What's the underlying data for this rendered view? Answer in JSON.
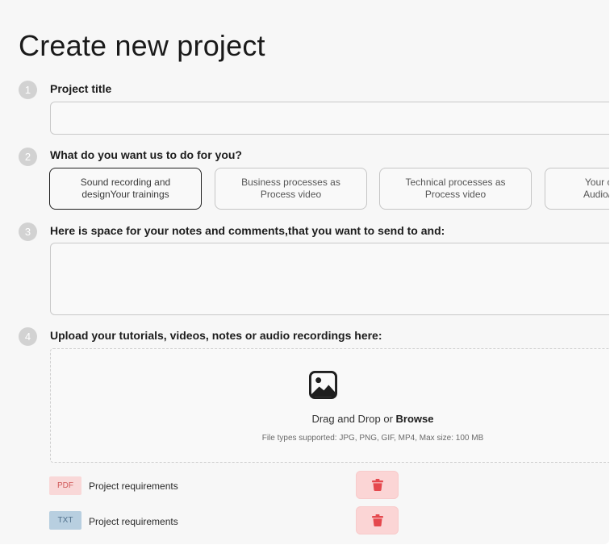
{
  "page_title": "Create new project",
  "steps": [
    {
      "number": "1",
      "label": "Project title"
    },
    {
      "number": "2",
      "label": "What do you want us to do for you?"
    },
    {
      "number": "3",
      "label": "Here is space for your notes and comments,that you want to send to and:"
    },
    {
      "number": "4",
      "label": "Upload your tutorials, videos, notes or audio recordings here:"
    }
  ],
  "project_title": {
    "value": "",
    "placeholder": ""
  },
  "options": [
    {
      "label": "Sound recording and designYour trainings",
      "selected": true
    },
    {
      "label": "Business processes as Process video",
      "selected": false
    },
    {
      "label": "Technical processes as Process video",
      "selected": false
    },
    {
      "label": "Your or Audio/V",
      "selected": false
    }
  ],
  "notes": {
    "value": "",
    "placeholder": ""
  },
  "upload": {
    "drag_text": "Drag and Drop or",
    "browse_label": "Browse",
    "supported_text": "File types supported: JPG, PNG, GIF, MP4, Max size: 100 MB"
  },
  "files": [
    {
      "type": "PDF",
      "name": "Project requirements"
    },
    {
      "type": "TXT",
      "name": "Project requirements"
    }
  ],
  "colors": {
    "background": "#f7f7f7",
    "delete_bg": "#fbd5d5",
    "delete_icon": "#e5484d",
    "pdf_badge": "#f9d8d8",
    "txt_badge": "#b8cfe0",
    "step_circle": "#d2d2d2"
  },
  "icons": {
    "upload": "image-icon",
    "delete": "trash-icon"
  }
}
